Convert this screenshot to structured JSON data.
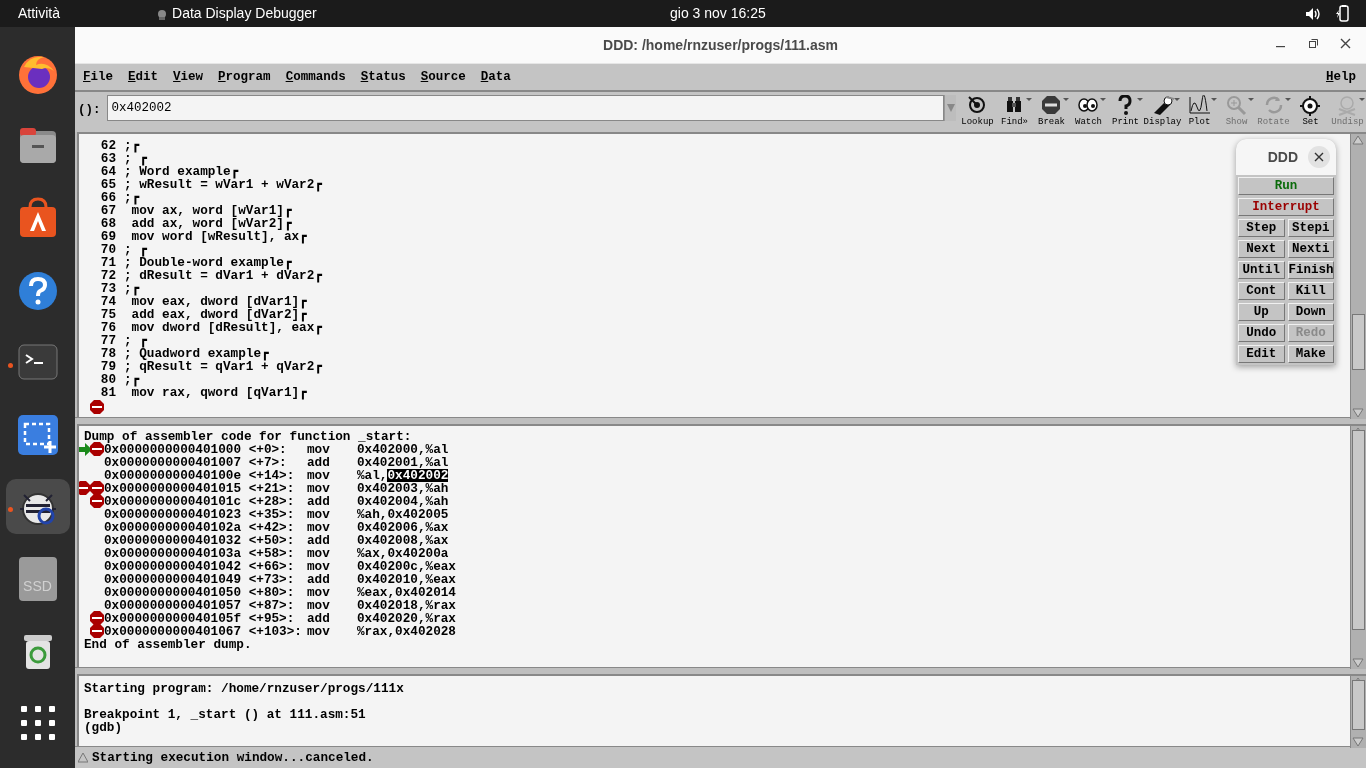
{
  "top_bar": {
    "activities": "Attività",
    "app_name": "Data Display Debugger",
    "clock": "gio 3 nov  16:25"
  },
  "dock": [
    {
      "kind": "browser",
      "running": false,
      "selected": false
    },
    {
      "kind": "files",
      "running": false,
      "selected": false
    },
    {
      "kind": "software",
      "running": false,
      "selected": false
    },
    {
      "kind": "help",
      "running": false,
      "selected": false
    },
    {
      "kind": "terminal",
      "running": true,
      "selected": false
    },
    {
      "kind": "screenshot",
      "running": false,
      "selected": false
    },
    {
      "kind": "debugger",
      "running": true,
      "selected": true
    },
    {
      "kind": "drive",
      "label": "SSD",
      "running": false,
      "selected": false
    },
    {
      "kind": "trash",
      "running": false,
      "selected": false
    },
    {
      "kind": "apps",
      "running": false,
      "selected": false
    }
  ],
  "window": {
    "title": "DDD: /home/rnzuser/progs/111.asm"
  },
  "menu": [
    "File",
    "Edit",
    "View",
    "Program",
    "Commands",
    "Status",
    "Source",
    "Data"
  ],
  "help_menu": "Help",
  "argument": {
    "label": "():",
    "value": "0x402002"
  },
  "toolbar": [
    {
      "kind": "lookup",
      "label": "Lookup",
      "disabled": false,
      "dropdown": false
    },
    {
      "kind": "find",
      "label": "Find»",
      "disabled": false,
      "dropdown": true
    },
    {
      "kind": "break",
      "label": "Break",
      "disabled": false,
      "dropdown": true
    },
    {
      "kind": "watch",
      "label": "Watch",
      "disabled": false,
      "dropdown": true
    },
    {
      "kind": "print",
      "label": "Print",
      "disabled": false,
      "dropdown": true
    },
    {
      "kind": "display",
      "label": "Display",
      "disabled": false,
      "dropdown": true
    },
    {
      "kind": "plot",
      "label": "Plot",
      "disabled": false,
      "dropdown": true
    },
    {
      "kind": "show",
      "label": "Show",
      "disabled": true,
      "dropdown": true
    },
    {
      "kind": "rotate",
      "label": "Rotate",
      "disabled": true,
      "dropdown": true
    },
    {
      "kind": "set",
      "label": "Set",
      "disabled": false,
      "dropdown": false
    },
    {
      "kind": "undisp",
      "label": "Undisp",
      "disabled": true,
      "dropdown": true
    }
  ],
  "source": {
    "lines": [
      {
        "number": "62",
        "text": ";┏"
      },
      {
        "number": "63",
        "text": "; ┏"
      },
      {
        "number": "64",
        "text": "; Word example┏"
      },
      {
        "number": "65",
        "text": "; wResult = wVar1 + wVar2┏"
      },
      {
        "number": "66",
        "text": ";┏"
      },
      {
        "number": "67",
        "text": " mov ax, word [wVar1]┏"
      },
      {
        "number": "68",
        "text": " add ax, word [wVar2]┏"
      },
      {
        "number": "69",
        "text": " mov word [wResult], ax┏"
      },
      {
        "number": "70",
        "text": "; ┏"
      },
      {
        "number": "71",
        "text": "; Double-word example┏"
      },
      {
        "number": "72",
        "text": "; dResult = dVar1 + dVar2┏"
      },
      {
        "number": "73",
        "text": ";┏"
      },
      {
        "number": "74",
        "text": " mov eax, dword [dVar1]┏"
      },
      {
        "number": "75",
        "text": " add eax, dword [dVar2]┏"
      },
      {
        "number": "76",
        "text": " mov dword [dResult], eax┏"
      },
      {
        "number": "77",
        "text": "; ┏"
      },
      {
        "number": "78",
        "text": "; Quadword example┏"
      },
      {
        "number": "79",
        "text": "; qResult = qVar1 + qVar2┏"
      },
      {
        "number": "80",
        "text": ";┏"
      },
      {
        "number": "81",
        "text": " mov rax, qword [qVar1]┏"
      }
    ],
    "breakpoint_below": true
  },
  "assembler": {
    "header": "Dump of assembler code for function _start:",
    "footer": "End of assembler dump.",
    "rows": [
      {
        "address": "0x0000000000401000 <+0>:",
        "op": "mov",
        "operand": "0x402000,%al",
        "breakpoints": [
          {
            "enabled": true
          }
        ],
        "current": true
      },
      {
        "address": "0x0000000000401007 <+7>:",
        "op": "add",
        "operand": "0x402001,%al",
        "breakpoints": [],
        "current": false
      },
      {
        "address": "0x000000000040100e <+14>:",
        "op": "mov",
        "operand": "%al,",
        "operand_selected": "0x402002",
        "breakpoints": [],
        "current": false
      },
      {
        "address": "0x0000000000401015 <+21>:",
        "op": "mov",
        "operand": "0x402003,%ah",
        "breakpoints": [
          {
            "enabled": true
          },
          {
            "enabled": true
          }
        ],
        "current": false
      },
      {
        "address": "0x000000000040101c <+28>:",
        "op": "add",
        "operand": "0x402004,%ah",
        "breakpoints": [
          {
            "enabled": true
          }
        ],
        "current": false
      },
      {
        "address": "0x0000000000401023 <+35>:",
        "op": "mov",
        "operand": "%ah,0x402005",
        "breakpoints": [],
        "current": false
      },
      {
        "address": "0x000000000040102a <+42>:",
        "op": "mov",
        "operand": "0x402006,%ax",
        "breakpoints": [],
        "current": false
      },
      {
        "address": "0x0000000000401032 <+50>:",
        "op": "add",
        "operand": "0x402008,%ax",
        "breakpoints": [],
        "current": false
      },
      {
        "address": "0x000000000040103a <+58>:",
        "op": "mov",
        "operand": "%ax,0x40200a",
        "breakpoints": [],
        "current": false
      },
      {
        "address": "0x0000000000401042 <+66>:",
        "op": "mov",
        "operand": "0x40200c,%eax",
        "breakpoints": [],
        "current": false
      },
      {
        "address": "0x0000000000401049 <+73>:",
        "op": "add",
        "operand": "0x402010,%eax",
        "breakpoints": [],
        "current": false
      },
      {
        "address": "0x0000000000401050 <+80>:",
        "op": "mov",
        "operand": "%eax,0x402014",
        "breakpoints": [],
        "current": false
      },
      {
        "address": "0x0000000000401057 <+87>:",
        "op": "mov",
        "operand": "0x402018,%rax",
        "breakpoints": [],
        "current": false
      },
      {
        "address": "0x000000000040105f <+95>:",
        "op": "add",
        "operand": "0x402020,%rax",
        "breakpoints": [
          {
            "enabled": true
          }
        ],
        "current": false
      },
      {
        "address": "0x0000000000401067 <+103>:",
        "op": "mov",
        "operand": "%rax,0x402028",
        "breakpoints": [
          {
            "enabled": true
          }
        ],
        "current": false
      }
    ]
  },
  "console": [
    {
      "text": "Starting program: /home/rnzuser/progs/111x",
      "blank_before": false
    },
    {
      "text": "Breakpoint 1, _start () at 111.asm:51",
      "blank_before": true
    },
    {
      "text": "(gdb)",
      "blank_before": false
    }
  ],
  "status_bar": "Starting execution window...canceled.",
  "command_tool": {
    "title": "DDD",
    "buttons": [
      {
        "label": "Run",
        "kind": "go",
        "disabled": false,
        "wide": true
      },
      {
        "label": "Interrupt",
        "kind": "stop",
        "disabled": false,
        "wide": true
      },
      {
        "label": "Step",
        "kind": "normal",
        "disabled": false,
        "wide": false
      },
      {
        "label": "Stepi",
        "kind": "normal",
        "disabled": false,
        "wide": false
      },
      {
        "label": "Next",
        "kind": "normal",
        "disabled": false,
        "wide": false
      },
      {
        "label": "Nexti",
        "kind": "normal",
        "disabled": false,
        "wide": false
      },
      {
        "label": "Until",
        "kind": "normal",
        "disabled": false,
        "wide": false
      },
      {
        "label": "Finish",
        "kind": "normal",
        "disabled": false,
        "wide": false
      },
      {
        "label": "Cont",
        "kind": "normal",
        "disabled": false,
        "wide": false
      },
      {
        "label": "Kill",
        "kind": "normal",
        "disabled": false,
        "wide": false
      },
      {
        "label": "Up",
        "kind": "normal",
        "disabled": false,
        "wide": false
      },
      {
        "label": "Down",
        "kind": "normal",
        "disabled": false,
        "wide": false
      },
      {
        "label": "Undo",
        "kind": "normal",
        "disabled": false,
        "wide": false
      },
      {
        "label": "Redo",
        "kind": "normal",
        "disabled": true,
        "wide": false
      },
      {
        "label": "Edit",
        "kind": "normal",
        "disabled": false,
        "wide": false
      },
      {
        "label": "Make",
        "kind": "normal",
        "disabled": false,
        "wide": false
      }
    ]
  }
}
